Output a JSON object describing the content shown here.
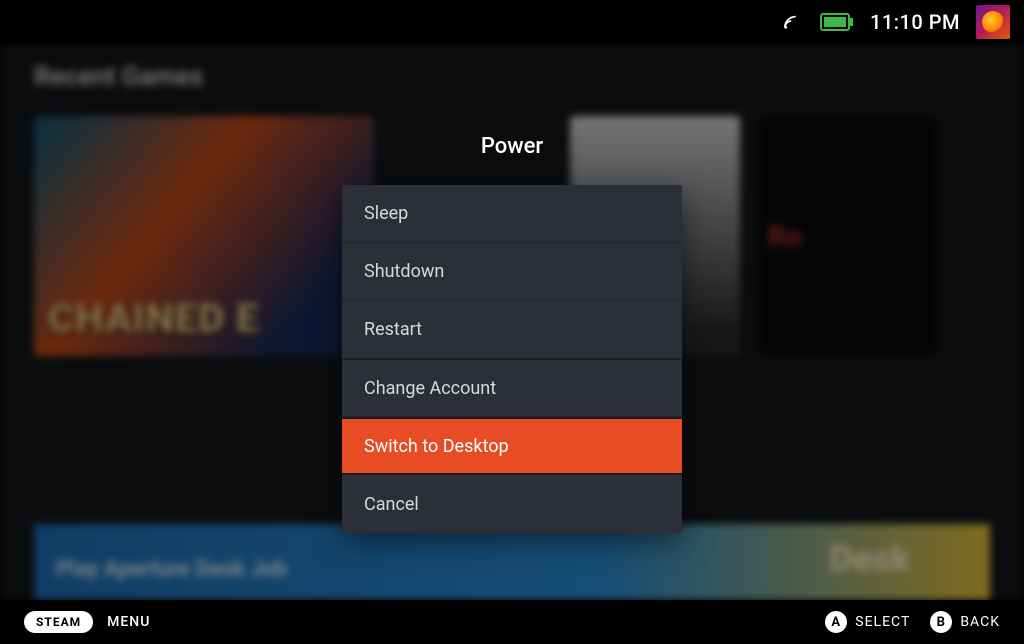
{
  "status": {
    "time": "11:10 PM"
  },
  "background": {
    "heading": "Recent Games",
    "tile1_title": "CHAINED E",
    "tile3_text": "Ro",
    "banner_text": "Play Aperture Desk Job",
    "banner_desk": "Desk"
  },
  "modal": {
    "title": "Power",
    "items": {
      "sleep": "Sleep",
      "shutdown": "Shutdown",
      "restart": "Restart",
      "change_account": "Change Account",
      "switch_desktop": "Switch to Desktop",
      "cancel": "Cancel"
    },
    "highlighted": "switch_desktop"
  },
  "footer": {
    "steam_label": "STEAM",
    "menu_label": "MENU",
    "a_glyph": "A",
    "a_label": "SELECT",
    "b_glyph": "B",
    "b_label": "BACK"
  }
}
